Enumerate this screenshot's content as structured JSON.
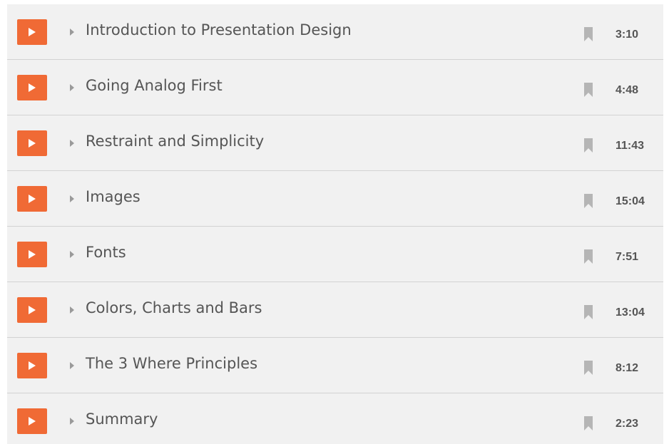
{
  "lessons": [
    {
      "title": "Introduction to Presentation Design",
      "duration": "3:10"
    },
    {
      "title": "Going Analog First",
      "duration": "4:48"
    },
    {
      "title": "Restraint and Simplicity",
      "duration": "11:43"
    },
    {
      "title": "Images",
      "duration": "15:04"
    },
    {
      "title": "Fonts",
      "duration": "7:51"
    },
    {
      "title": "Colors, Charts and Bars",
      "duration": "13:04"
    },
    {
      "title": "The 3 Where Principles",
      "duration": "8:12"
    },
    {
      "title": "Summary",
      "duration": "2:23"
    }
  ],
  "icons": {
    "play": "play-icon",
    "expand": "caret-right-icon",
    "bookmark": "bookmark-icon"
  },
  "colors": {
    "play_button": "#f06a35",
    "row_background": "#f1f1f1",
    "text": "#555555",
    "bookmark": "#b5b5b5"
  }
}
